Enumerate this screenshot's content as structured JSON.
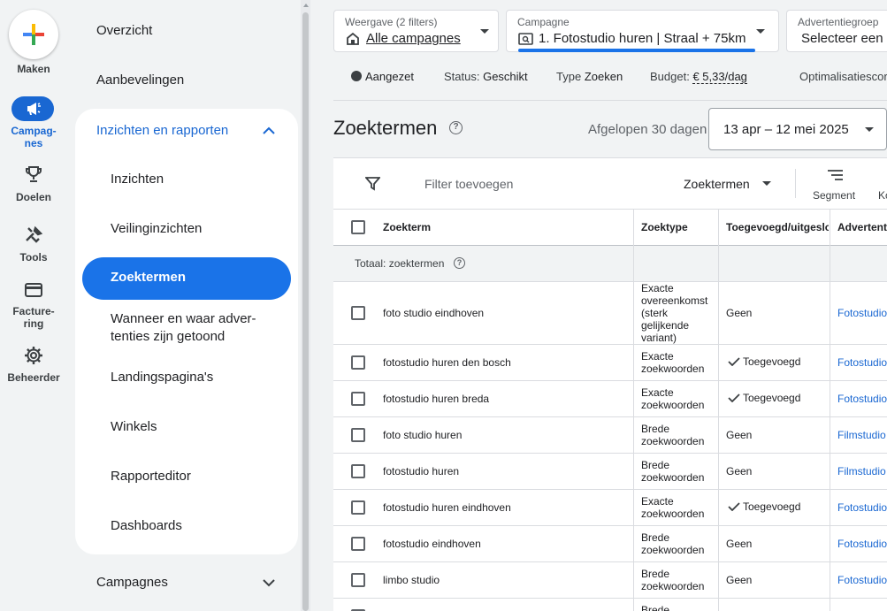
{
  "rail": {
    "make_label": "Maken",
    "items": [
      {
        "label": "Campag-\nnes",
        "icon": "megaphone-icon",
        "active": true
      },
      {
        "label": "Doelen",
        "icon": "trophy-icon"
      },
      {
        "label": "Tools",
        "icon": "tools-icon"
      },
      {
        "label": "Facture-\nring",
        "icon": "credit-card-icon"
      },
      {
        "label": "Beheerder",
        "icon": "gear-icon"
      }
    ]
  },
  "sidebar": {
    "overview": "Overzicht",
    "recommendations": "Aanbevelingen",
    "group_title": "Inzichten en rapporten",
    "sub_items": [
      "Inzichten",
      "Veilinginzichten",
      "Zoektermen",
      "Wanneer en waar adver-\ntenties zijn getoond",
      "Landingspagina's",
      "Winkels",
      "Rapporteditor",
      "Dashboards"
    ],
    "active_item": "Zoektermen",
    "campaigns": "Campagnes"
  },
  "header": {
    "view_label": "Weergave (2 filters)",
    "view_value": "Alle campagnes",
    "campaign_label": "Campagne",
    "campaign_value": "1. Fotostudio huren | Straal + 75km",
    "adgroup_label": "Advertentiegroep",
    "adgroup_value": "Selecteer een"
  },
  "status_bar": {
    "state": "Aangezet",
    "status_key": "Status:",
    "status_value": "Geschikt",
    "type_key": "Type",
    "type_value": "Zoeken",
    "budget_key": "Budget:",
    "budget_value": "€ 5,33/dag",
    "optimization": "Optimalisatiescore"
  },
  "page": {
    "title": "Zoektermen",
    "period_label": "Afgelopen 30 dagen",
    "date_range": "13 apr – 12 mei 2025"
  },
  "toolbar": {
    "filter_placeholder": "Filter toevoegen",
    "dropdown": "Zoektermen",
    "segment": "Segment",
    "k": "Ko"
  },
  "table": {
    "columns": [
      "Zoekterm",
      "Zoektype",
      "Toegevoegd/uitgesloten",
      "Advertentiegroep"
    ],
    "total_label": "Totaal: zoektermen",
    "rows": [
      {
        "term": "foto studio eindhoven",
        "type": "Exacte overeenkomst (sterk gelijkende variant)",
        "added": "Geen",
        "adgroup": "Fotostudio"
      },
      {
        "term": "fotostudio huren den bosch",
        "type": "Exacte zoekwoorden",
        "added": "Toegevoegd",
        "adgroup": "Fotostudio"
      },
      {
        "term": "fotostudio huren breda",
        "type": "Exacte zoekwoorden",
        "added": "Toegevoegd",
        "adgroup": "Fotostudio"
      },
      {
        "term": "foto studio huren",
        "type": "Brede zoekwoorden",
        "added": "Geen",
        "adgroup": "Filmstudio"
      },
      {
        "term": "fotostudio huren",
        "type": "Brede zoekwoorden",
        "added": "Geen",
        "adgroup": "Filmstudio"
      },
      {
        "term": "fotostudio huren eindhoven",
        "type": "Exacte zoekwoorden",
        "added": "Toegevoegd",
        "adgroup": "Fotostudio"
      },
      {
        "term": "fotostudio eindhoven",
        "type": "Brede zoekwoorden",
        "added": "Geen",
        "adgroup": "Fotostudio"
      },
      {
        "term": "limbo studio",
        "type": "Brede zoekwoorden",
        "added": "Geen",
        "adgroup": "Fotostudio"
      },
      {
        "term": "",
        "type": "Brede",
        "added": "",
        "adgroup": ""
      }
    ]
  },
  "colors": {
    "accent": "#1a73e8",
    "link": "#1967d2"
  }
}
